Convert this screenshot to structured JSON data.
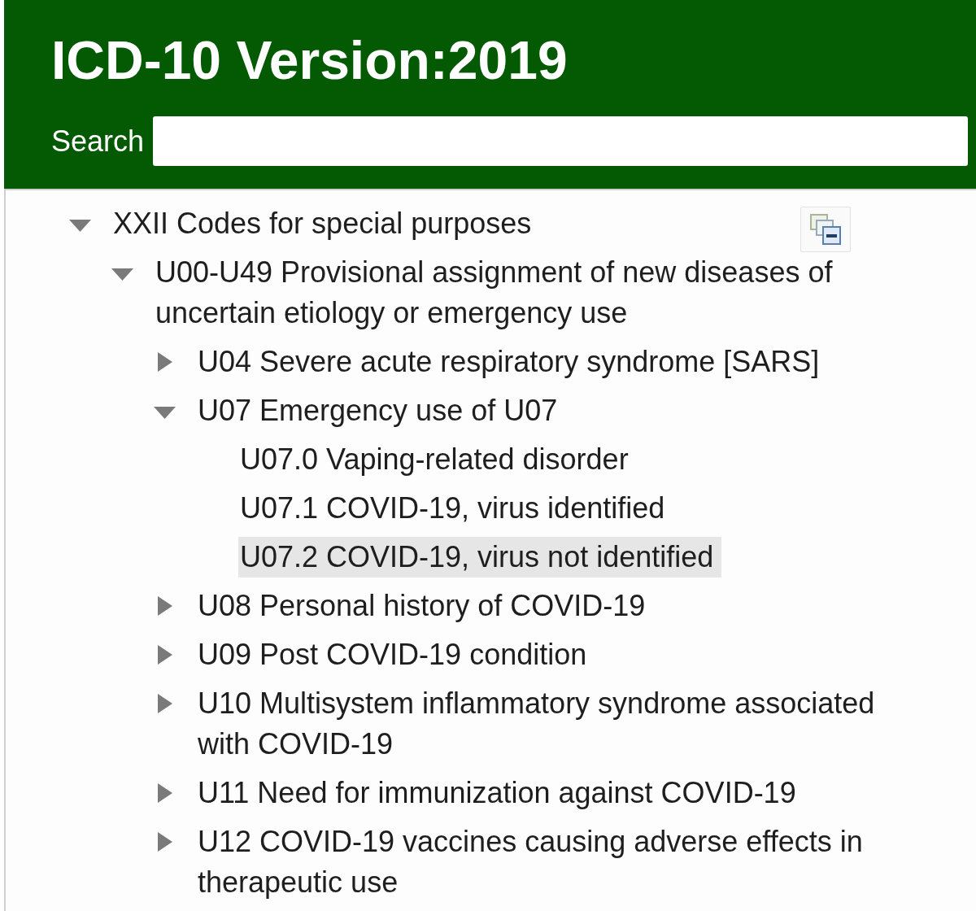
{
  "header": {
    "title": "ICD-10 Version:2019",
    "search": {
      "label": "Search"
    }
  },
  "tree": {
    "items": [
      {
        "label": "XXII Codes for special purposes",
        "expanded": true,
        "selected": false,
        "children": [
          {
            "label": "U00-U49 Provisional assignment of new diseases of uncertain etiology or emergency use",
            "expanded": true,
            "selected": false,
            "children": [
              {
                "label": "U04 Severe acute respiratory syndrome [SARS]",
                "expanded": false,
                "selected": false
              },
              {
                "label": "U07 Emergency use of U07",
                "expanded": true,
                "selected": false,
                "children": [
                  {
                    "label": "U07.0 Vaping-related disorder",
                    "selected": false
                  },
                  {
                    "label": "U07.1 COVID-19, virus identified",
                    "selected": false
                  },
                  {
                    "label": "U07.2 COVID-19, virus not identified",
                    "selected": true
                  }
                ]
              },
              {
                "label": "U08 Personal history of COVID-19",
                "expanded": false,
                "selected": false
              },
              {
                "label": "U09 Post COVID-19 condition",
                "expanded": false,
                "selected": false
              },
              {
                "label": "U10 Multisystem inflammatory syndrome associated with COVID-19",
                "expanded": false,
                "selected": false
              },
              {
                "label": "U11 Need for immunization against COVID-19",
                "expanded": false,
                "selected": false
              },
              {
                "label": "U12 COVID-19 vaccines causing adverse effects in therapeutic use",
                "expanded": false,
                "selected": false
              }
            ]
          }
        ]
      }
    ]
  }
}
